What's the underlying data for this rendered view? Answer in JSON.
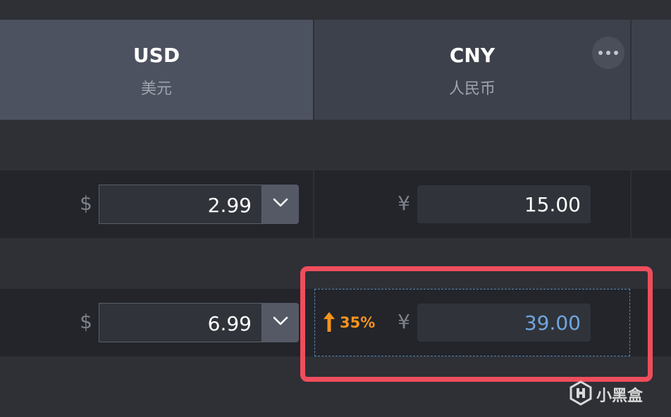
{
  "header": {
    "usd": {
      "code": "USD",
      "name": "美元"
    },
    "cny": {
      "code": "CNY",
      "name": "人民币"
    },
    "more_icon": "ellipsis-icon"
  },
  "rows": [
    {
      "usd_symbol": "$",
      "usd_value": "2.99",
      "cny_symbol": "¥",
      "cny_value": "15.00",
      "cny_value_color": "#ffffff"
    },
    {
      "usd_symbol": "$",
      "usd_value": "6.99",
      "change_icon": "arrow-up-icon",
      "change_percent": "35%",
      "change_color": "#f7941d",
      "cny_symbol": "¥",
      "cny_value": "39.00",
      "cny_value_color": "#6fa6e0"
    }
  ],
  "highlight_color": "#f04d5c",
  "watermark": {
    "text": "小黑盒",
    "icon": "xiaoheihe-logo"
  }
}
